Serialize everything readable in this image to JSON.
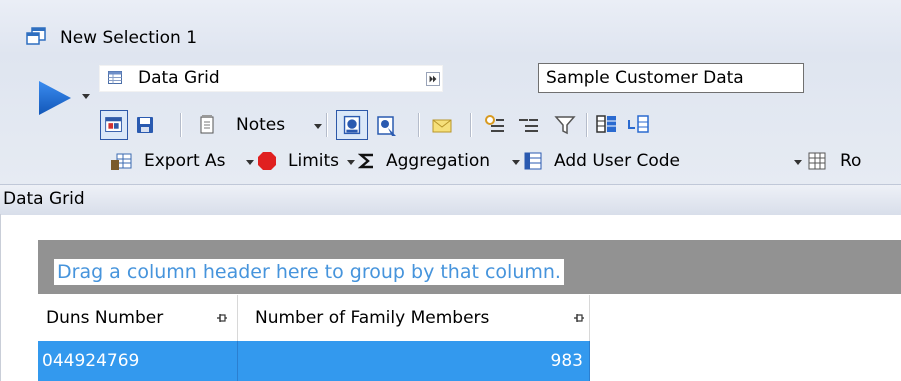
{
  "window": {
    "title": "New Selection 1"
  },
  "toolbar": {
    "view_selector": {
      "label": "Data Grid"
    },
    "dataset_name": "Sample Customer Data",
    "notes_label": "Notes",
    "export_label": "Export As",
    "limits_label": "Limits",
    "aggregation_label": "Aggregation",
    "add_user_code_label": "Add User Code",
    "overflow_label": "Ro"
  },
  "section": {
    "title": "Data Grid"
  },
  "grid": {
    "group_hint": "Drag a column header here to group by that column.",
    "columns": [
      {
        "label": "Duns Number"
      },
      {
        "label": "Number of Family Members"
      }
    ],
    "rows": [
      {
        "duns_number": "044924769",
        "family_members": "983"
      }
    ]
  },
  "colors": {
    "selection": "#3399ee",
    "group_panel": "#929292",
    "hint_text": "#4694dc",
    "run_arrow": "#1e6fd0"
  }
}
